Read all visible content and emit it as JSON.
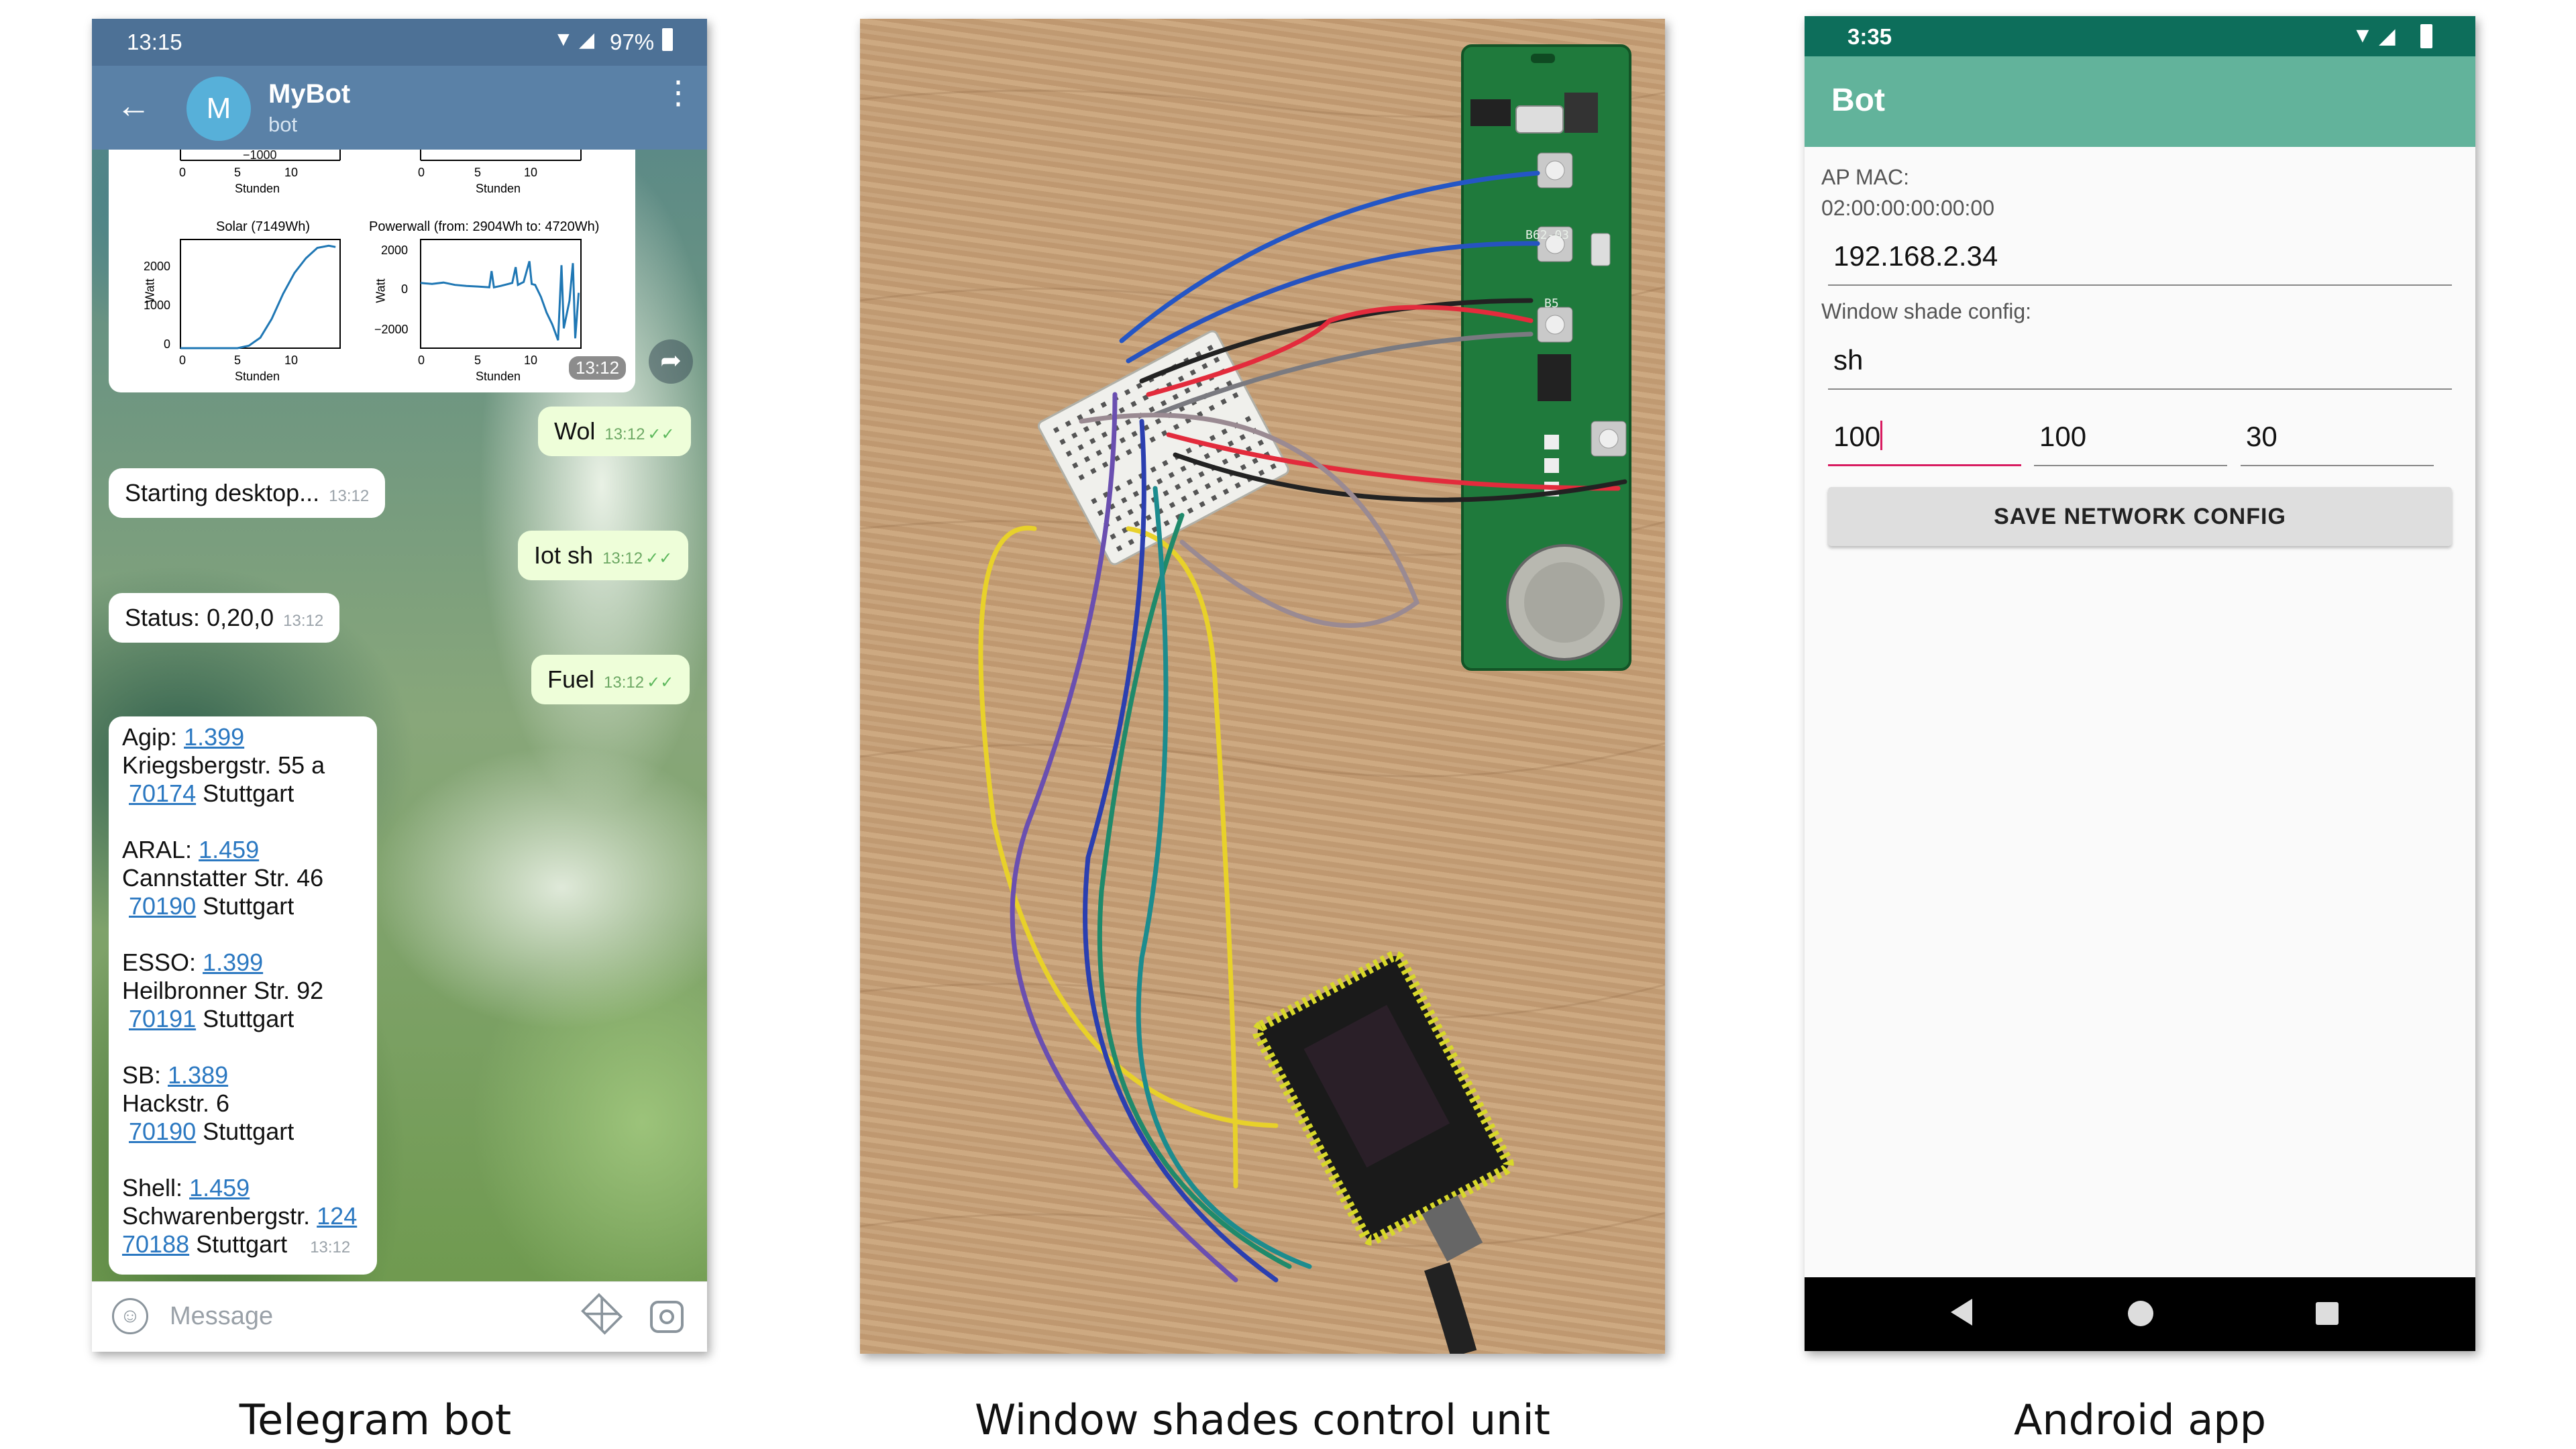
{
  "telegram": {
    "status_time": "13:15",
    "status_battery": "97%",
    "avatar_letter": "M",
    "bot_name": "MyBot",
    "bot_subtitle": "bot",
    "charts": {
      "top_left_xlabel": "Stunden",
      "top_right_xlabel": "Stunden",
      "top_left_ticks": [
        "0",
        "5",
        "10"
      ],
      "top_right_ticks": [
        "0",
        "5",
        "10"
      ],
      "top_right_partial_tick": "−1000",
      "solar_title": "Solar (7149Wh)",
      "solar_ylabel": "Watt",
      "solar_xlabel": "Stunden",
      "solar_yticks": [
        "2000",
        "1000",
        "0"
      ],
      "solar_xticks": [
        "0",
        "5",
        "10"
      ],
      "power_title": "Powerwall (from: 2904Wh to: 4720Wh)",
      "power_ylabel": "Watt",
      "power_xlabel": "Stunden",
      "power_yticks": [
        "2000",
        "0",
        "−2000"
      ],
      "power_xticks": [
        "0",
        "5",
        "10"
      ],
      "time": "13:12",
      "line_color": "#1f77b4"
    },
    "messages": [
      {
        "text": "Wol",
        "time": "13:12",
        "direction": "out"
      },
      {
        "text": "Starting desktop...",
        "time": "13:12",
        "direction": "in"
      },
      {
        "text": "Iot sh",
        "time": "13:12",
        "direction": "out"
      },
      {
        "text": "Status: 0,20,0",
        "time": "13:12",
        "direction": "in"
      },
      {
        "text": "Fuel",
        "time": "13:12",
        "direction": "out"
      }
    ],
    "fuel": {
      "stations": [
        {
          "name": "Agip: ",
          "price": "1.399",
          "street": "Kriegsbergstr. 55 a",
          "zip": "70174",
          "city": " Stuttgart"
        },
        {
          "name": "ARAL: ",
          "price": "1.459",
          "street": "Cannstatter Str. 46",
          "zip": "70190",
          "city": " Stuttgart"
        },
        {
          "name": "ESSO: ",
          "price": "1.399",
          "street": "Heilbronner Str. 92",
          "zip": "70191",
          "city": " Stuttgart"
        },
        {
          "name": "SB: ",
          "price": "1.389",
          "street": "Hackstr. 6",
          "zip": "70190",
          "city": " Stuttgart"
        },
        {
          "name": "Shell: ",
          "price": "1.459",
          "street": "Schwarenbergstr. ",
          "street_link": "124",
          "zip": "70188",
          "city": " Stuttgart"
        }
      ],
      "time": "13:12"
    },
    "input_placeholder": "Message",
    "icons": {
      "back": "arrow-left-icon",
      "menu": "more-vert-icon",
      "emoji": "emoji-icon",
      "attach": "paperclip-icon",
      "camera": "camera-icon",
      "forward": "share-icon"
    }
  },
  "photo": {
    "board_labels": [
      "B62-03",
      "B5"
    ]
  },
  "android": {
    "status_time": "3:35",
    "app_title": "Bot",
    "ap_mac_label": "AP MAC:",
    "ap_mac_value": "02:00:00:00:00:00",
    "ip_value": "192.168.2.34",
    "shade_label": "Window shade config:",
    "shade_value": "sh",
    "field_1": "100",
    "field_2": "100",
    "field_3": "30",
    "save_label": "SAVE NETWORK CONFIG",
    "accent_color": "#62b39b",
    "focus_color": "#d81b60"
  },
  "captions": {
    "left": "Telegram bot",
    "middle": "Window shades control unit",
    "right": "Android app"
  }
}
